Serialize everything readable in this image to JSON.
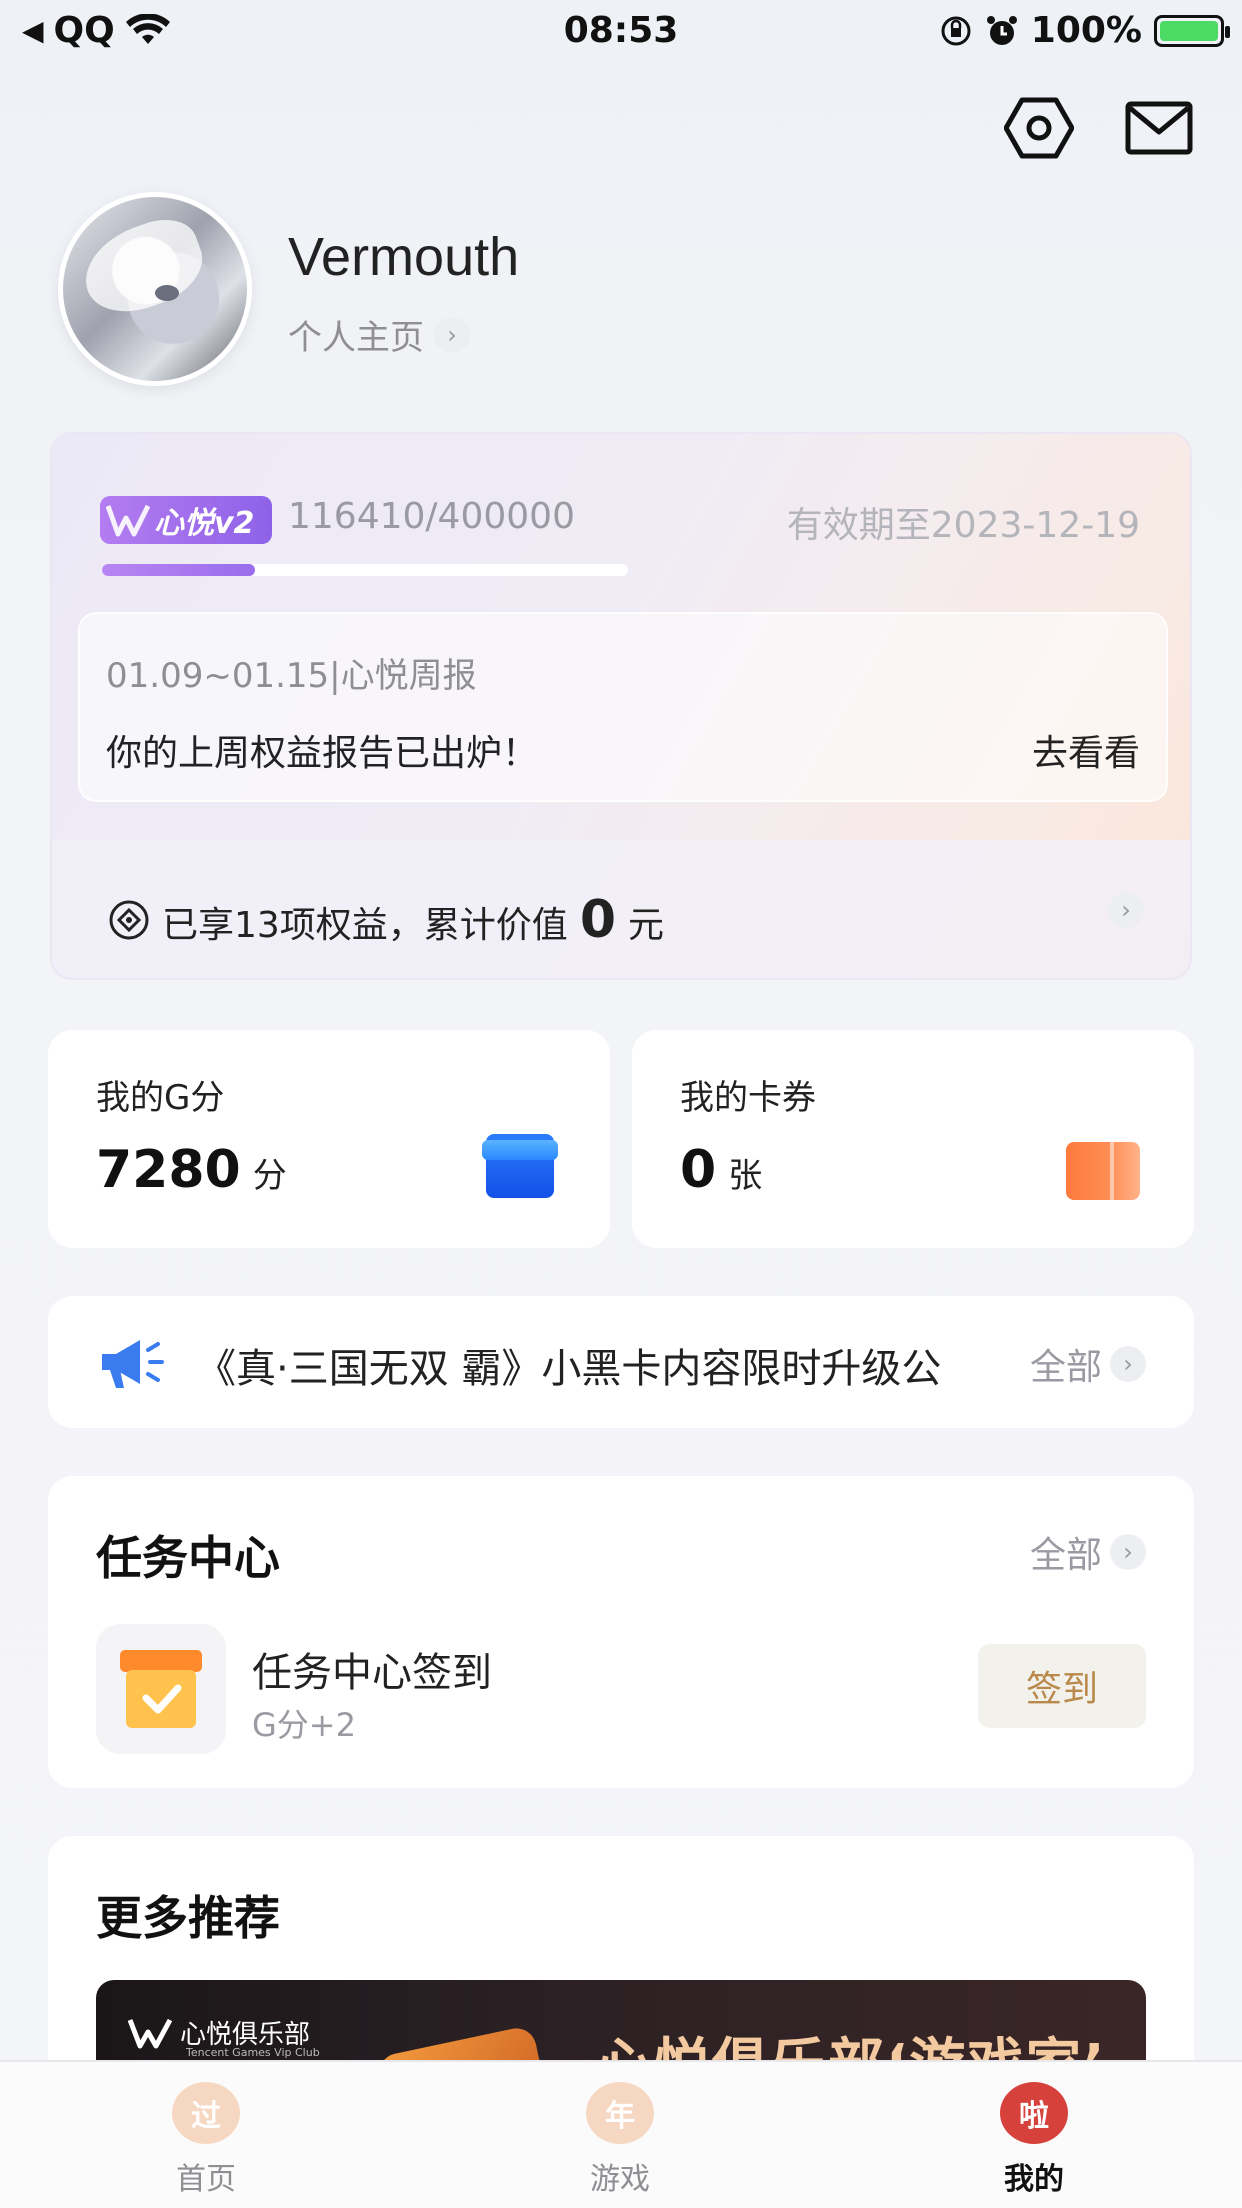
{
  "status_bar": {
    "back_app": "QQ",
    "time": "08:53",
    "battery": "100%"
  },
  "profile": {
    "username": "Vermouth",
    "homepage_link": "个人主页"
  },
  "vip": {
    "badge": "心悦v2",
    "progress_text": "116410/400000",
    "progress_fraction": 0.291,
    "expiry": "有效期至2023-12-19",
    "weekly_date": "01.09~01.15|心悦周报",
    "weekly_message": "你的上周权益报告已出炉！",
    "weekly_action": "去看看",
    "benefits_prefix": "已享13项权益，累计价值",
    "benefits_value": "0",
    "benefits_unit": "元"
  },
  "g_points": {
    "label": "我的G分",
    "value": "7280",
    "unit": "分"
  },
  "coupons": {
    "label": "我的卡券",
    "value": "0",
    "unit": "张"
  },
  "announcement": {
    "text": "《真·三国无双 霸》小黑卡内容限时升级公",
    "all_label": "全部"
  },
  "task_center": {
    "title": "任务中心",
    "all_label": "全部",
    "task_name": "任务中心签到",
    "task_reward": "G分+2",
    "signin_label": "签到"
  },
  "more": {
    "title": "更多推荐",
    "banner_brand": "心悦俱乐部",
    "banner_brand_sub": "Tencent Games Vip Club",
    "banner_headline": "心悦俱乐部‘游戏家’"
  },
  "tabbar": {
    "tabs": [
      {
        "label": "首页",
        "glyph": "过"
      },
      {
        "label": "游戏",
        "glyph": "年"
      },
      {
        "label": "我的",
        "glyph": "啦"
      }
    ]
  },
  "colors": {
    "accent_purple": "#9a6cec",
    "gpoints_blue": "#1450e6",
    "coupon_orange": "#ff7a3d",
    "signin_gold": "#b8894a",
    "tab_active_red": "#d6423b"
  }
}
